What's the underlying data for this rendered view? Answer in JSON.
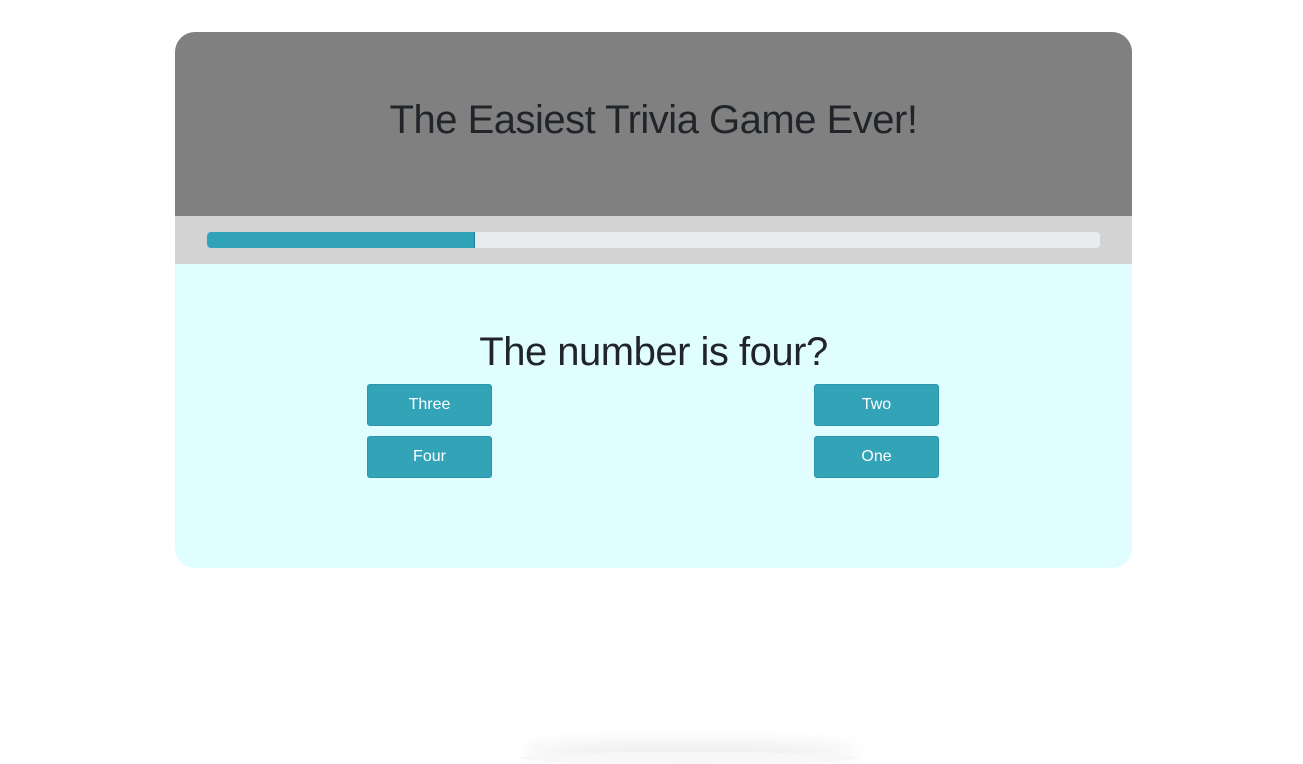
{
  "header": {
    "title": "The Easiest Trivia Game Ever!"
  },
  "progress": {
    "fraction": 0.3
  },
  "quiz": {
    "question": "The number is four?",
    "answers": [
      "Three",
      "Two",
      "Four",
      "One"
    ]
  },
  "colors": {
    "header_bg": "#808080",
    "progress_strip_bg": "#d3d3d3",
    "progress_fill": "#31a2b8",
    "body_bg": "#e0feff",
    "button_bg": "#33a3b8"
  }
}
